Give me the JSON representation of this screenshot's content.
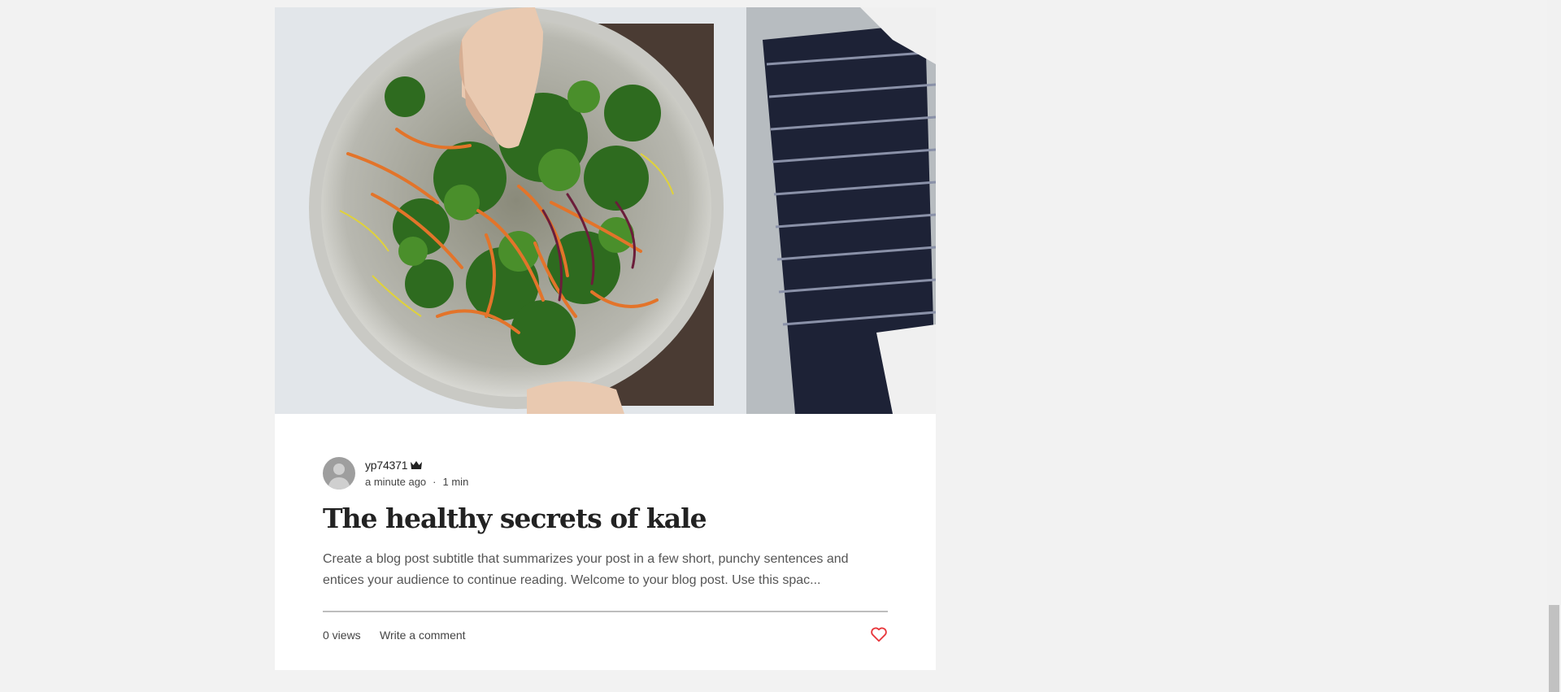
{
  "post": {
    "image": "salad-bowl-photo",
    "author": {
      "name": "yp74371",
      "badge_icon": "crown-icon"
    },
    "published": "a minute ago",
    "separator": "·",
    "read_time": "1 min",
    "title": "The healthy secrets of kale",
    "excerpt": "Create a blog post subtitle that summarizes your post in a few short, punchy sentences and entices your audience to continue reading. Welcome to your blog post. Use this spac...",
    "views": "0 views",
    "comment_label": "Write a comment",
    "like_icon": "heart-icon",
    "like_color": "#e8383d"
  },
  "colors": {
    "page_background": "#f2f2f2",
    "card_background": "#ffffff",
    "title": "#222222"
  }
}
